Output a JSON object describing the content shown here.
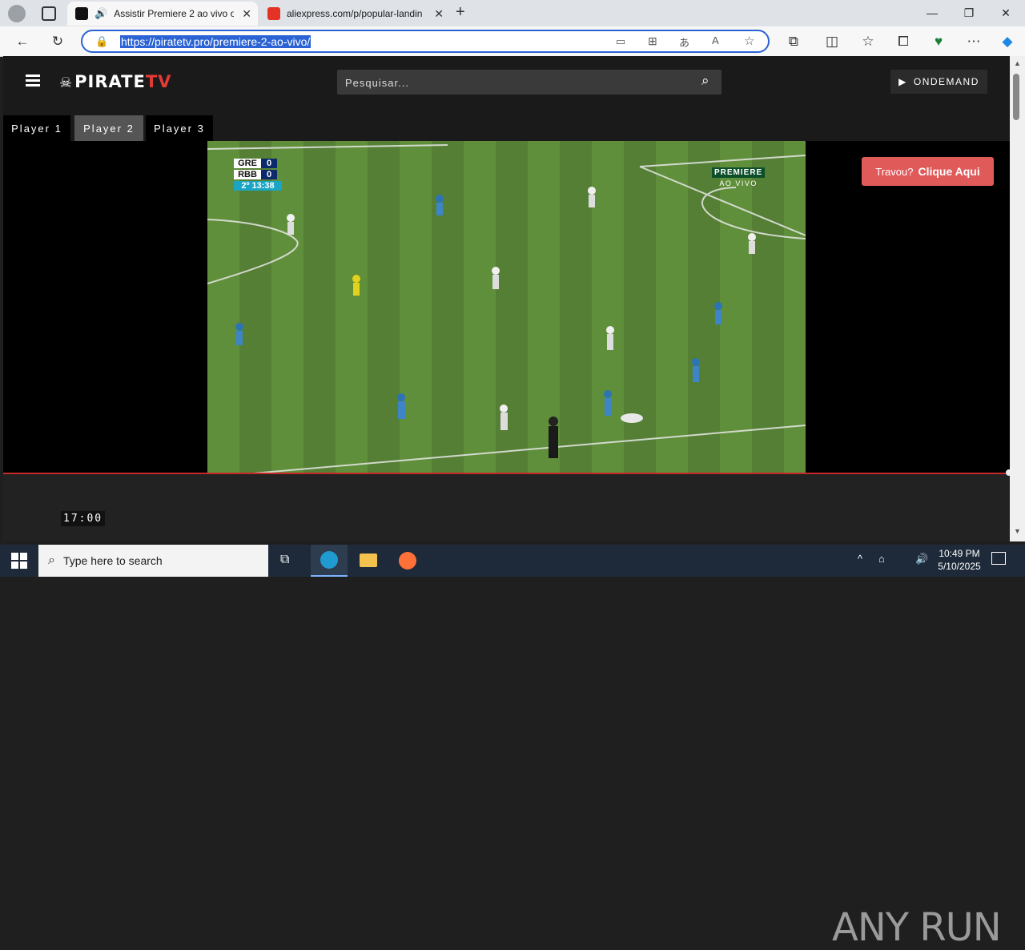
{
  "browser": {
    "tabs": [
      {
        "label": "Assistir Premiere 2 ao vivo o",
        "active": true
      },
      {
        "label": "aliexpress.com/p/popular-landin",
        "active": false
      }
    ],
    "url": "https://piratetv.pro/premiere-2-ao-vivo/"
  },
  "site": {
    "logo_text": "PIRATE",
    "logo_text_accent": "TV",
    "search_placeholder": "Pesquisar...",
    "ondemand_label": "ONDEMAND",
    "players": [
      "Player 1",
      "Player 2",
      "Player 3"
    ],
    "active_player": "Player 2",
    "travou_label": "Travou?",
    "travou_action": "Clique Aqui"
  },
  "video": {
    "scoreboard": {
      "team1": "GRE",
      "score1": "0",
      "team2": "RBB",
      "score2": "0",
      "clock": "2º 13:38"
    },
    "channel": "PREMIERE",
    "channel_sub": "AO VIVO",
    "time_display": "17:00"
  },
  "watermark": "ANY  RUN",
  "taskbar": {
    "search_placeholder": "Type here to search",
    "time": "10:49 PM",
    "date": "5/10/2025"
  },
  "colors": {
    "accent_red": "#e53935",
    "travou_bg": "#e05a5a",
    "url_highlight": "#2b63d4",
    "pitch_green": "#5a8a36"
  }
}
